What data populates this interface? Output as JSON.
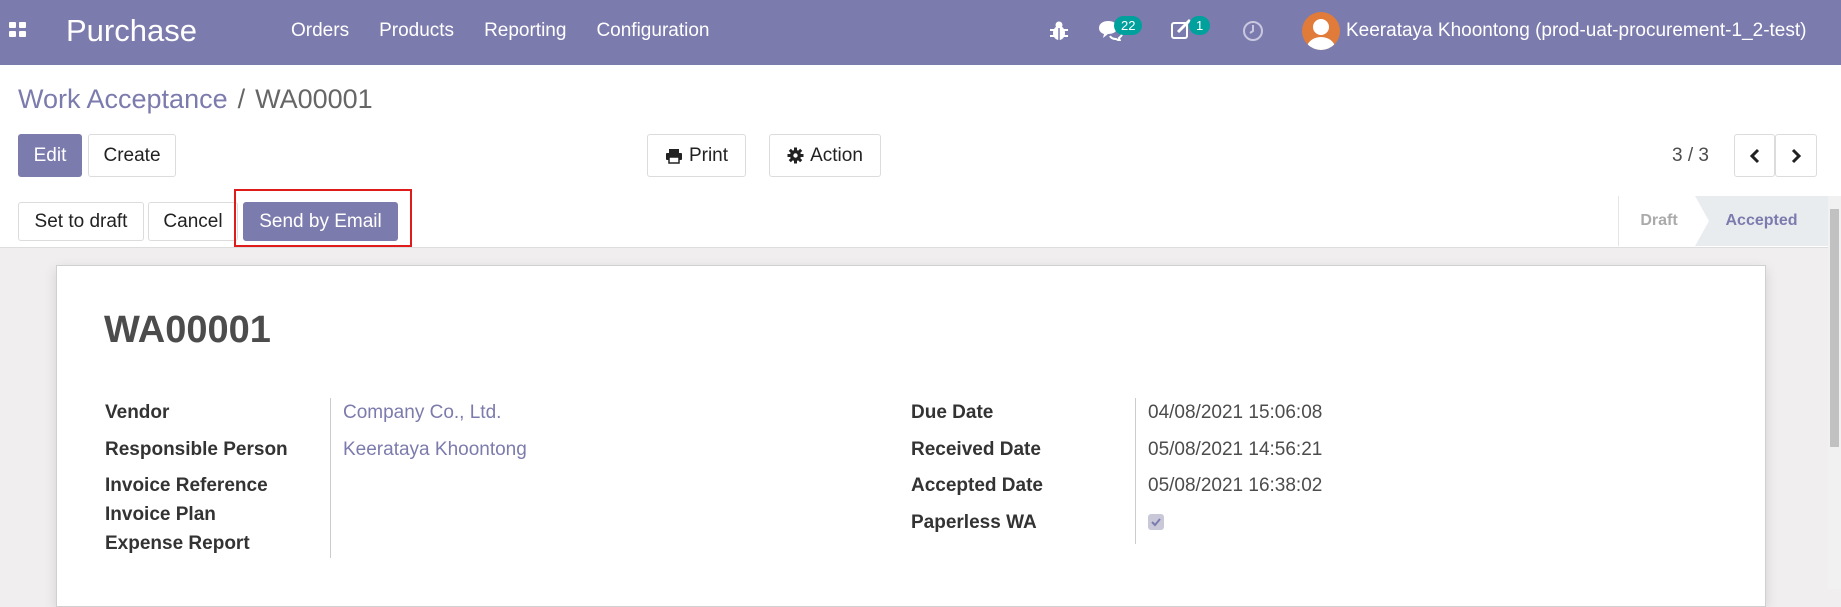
{
  "navbar": {
    "app_title": "Purchase",
    "menu": [
      "Orders",
      "Products",
      "Reporting",
      "Configuration"
    ],
    "messages_count": "22",
    "activities_count": "1",
    "user_name": "Keerataya Khoontong (prod-uat-procurement-1_2-test)"
  },
  "breadcrumb": {
    "parent": "Work Acceptance",
    "separator": "/",
    "current": "WA00001"
  },
  "buttons": {
    "edit": "Edit",
    "create": "Create",
    "print": "Print",
    "action": "Action",
    "set_to_draft": "Set to draft",
    "cancel": "Cancel",
    "send_by_email": "Send by Email"
  },
  "pager": {
    "value": "3 / 3"
  },
  "statusbar": {
    "stages": [
      "Draft",
      "Accepted"
    ],
    "active": "Accepted"
  },
  "record": {
    "name": "WA00001",
    "left_fields": [
      {
        "label": "Vendor",
        "value": "Company Co., Ltd."
      },
      {
        "label": "Responsible Person",
        "value": "Keerataya Khoontong"
      },
      {
        "label": "Invoice Reference",
        "value": ""
      },
      {
        "label": "Invoice Plan",
        "value": ""
      },
      {
        "label": "Expense Report",
        "value": ""
      }
    ],
    "right_fields": [
      {
        "label": "Due Date",
        "value": "04/08/2021 15:06:08"
      },
      {
        "label": "Received Date",
        "value": "05/08/2021 14:56:21"
      },
      {
        "label": "Accepted Date",
        "value": "05/08/2021 16:38:02"
      },
      {
        "label": "Paperless WA",
        "value": true
      }
    ]
  },
  "colors": {
    "brand": "#7c7bad",
    "badge": "#00a09d",
    "highlight": "#e01b1b"
  },
  "icons": [
    "apps-icon",
    "bug-icon",
    "chat-icon",
    "activity-icon",
    "clock-icon",
    "print-icon",
    "gear-icon",
    "chevron-left-icon",
    "chevron-right-icon",
    "check-icon"
  ]
}
